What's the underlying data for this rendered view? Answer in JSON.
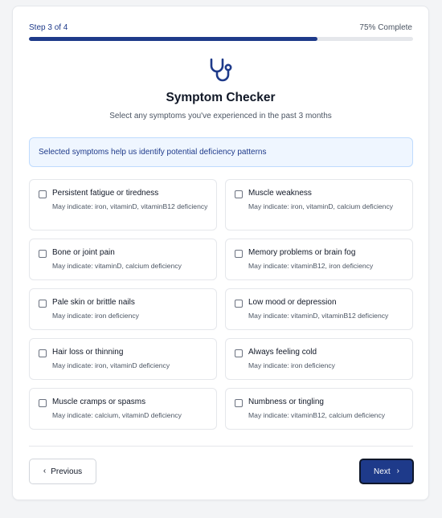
{
  "progress": {
    "step_label": "Step 3 of 4",
    "percent_label": "75% Complete",
    "fraction": 0.75
  },
  "header": {
    "icon": "stethoscope-icon",
    "title": "Symptom Checker",
    "subtitle": "Select any symptoms you've experienced in the past 3 months"
  },
  "info": {
    "text": "Selected symptoms help us identify potential deficiency patterns"
  },
  "symptoms": [
    {
      "label": "Persistent fatigue or tiredness",
      "hint": "May indicate: iron, vitaminD, vitaminB12 deficiency",
      "checked": false
    },
    {
      "label": "Muscle weakness",
      "hint": "May indicate: iron, vitaminD, calcium deficiency",
      "checked": false
    },
    {
      "label": "Bone or joint pain",
      "hint": "May indicate: vitaminD, calcium deficiency",
      "checked": false
    },
    {
      "label": "Memory problems or brain fog",
      "hint": "May indicate: vitaminB12, iron deficiency",
      "checked": false
    },
    {
      "label": "Pale skin or brittle nails",
      "hint": "May indicate: iron deficiency",
      "checked": false
    },
    {
      "label": "Low mood or depression",
      "hint": "May indicate: vitaminD, vitaminB12 deficiency",
      "checked": false
    },
    {
      "label": "Hair loss or thinning",
      "hint": "May indicate: iron, vitaminD deficiency",
      "checked": false
    },
    {
      "label": "Always feeling cold",
      "hint": "May indicate: iron deficiency",
      "checked": false
    },
    {
      "label": "Muscle cramps or spasms",
      "hint": "May indicate: calcium, vitaminD deficiency",
      "checked": false
    },
    {
      "label": "Numbness or tingling",
      "hint": "May indicate: vitaminB12, calcium deficiency",
      "checked": false
    }
  ],
  "nav": {
    "previous_label": "Previous",
    "next_label": "Next",
    "prev_icon": "chevron-left-icon",
    "next_icon": "chevron-right-icon"
  },
  "colors": {
    "accent": "#1e3a8a",
    "info_bg": "#eff6ff",
    "info_border": "#bfdbfe"
  }
}
